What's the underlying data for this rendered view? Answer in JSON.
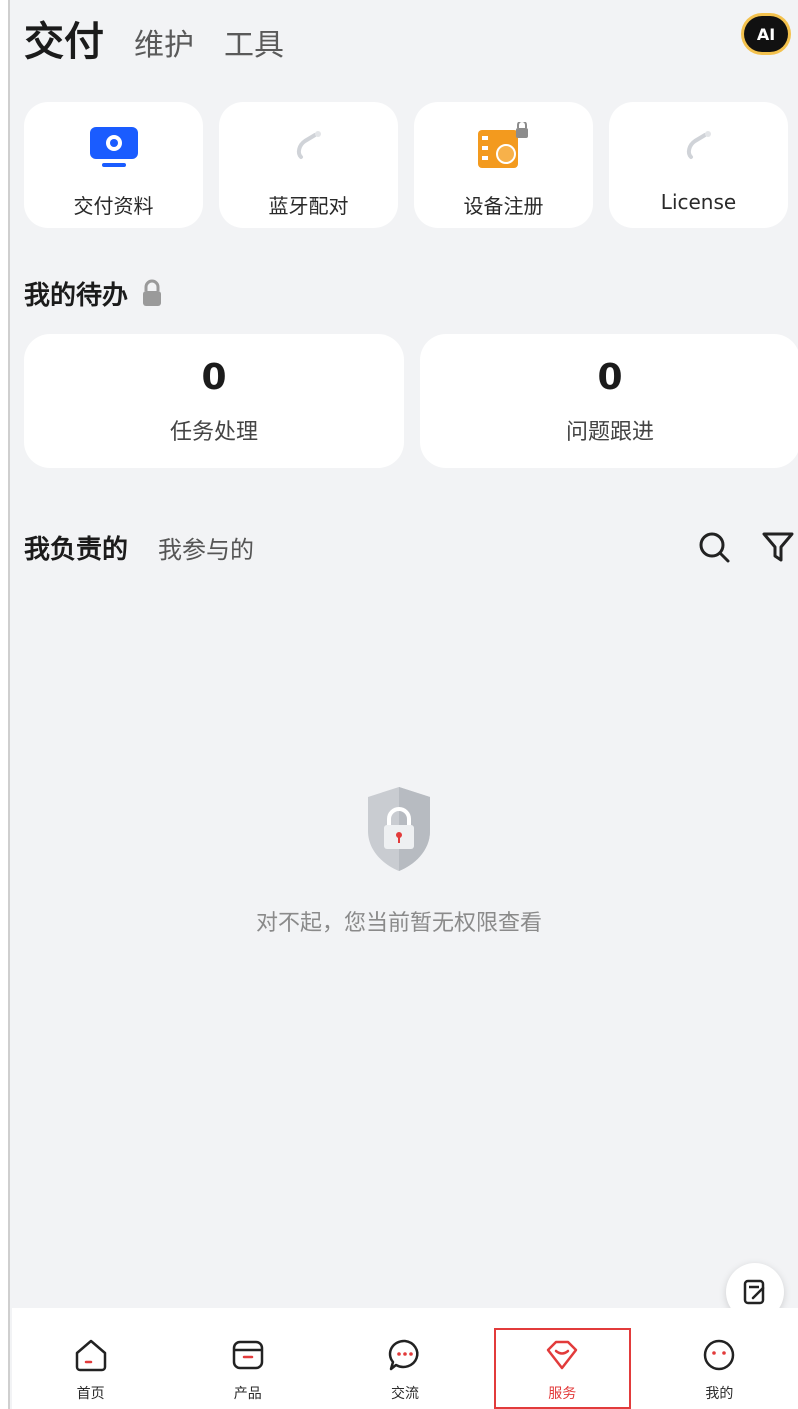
{
  "header": {
    "tabs": [
      "交付",
      "维护",
      "工具"
    ],
    "active_tab": "交付",
    "ai_badge": "AI"
  },
  "tools": [
    {
      "label": "交付资料",
      "icon": "monitor-icon",
      "color": "#1a5cff"
    },
    {
      "label": "蓝牙配对",
      "icon": "bluetooth-pairing-icon",
      "color": "#d0d3d8"
    },
    {
      "label": "设备注册",
      "icon": "device-register-icon",
      "color": "#f39a1e"
    },
    {
      "label": "License",
      "icon": "license-icon",
      "color": "#d0d3d8"
    }
  ],
  "todo": {
    "title": "我的待办",
    "items": [
      {
        "count": "0",
        "label": "任务处理"
      },
      {
        "count": "0",
        "label": "问题跟进"
      }
    ]
  },
  "segment": {
    "tabs": [
      "我负责的",
      "我参与的"
    ],
    "active": "我负责的"
  },
  "empty_state": {
    "message": "对不起，您当前暂无权限查看"
  },
  "bottom_nav": {
    "items": [
      {
        "label": "首页",
        "icon": "home-icon"
      },
      {
        "label": "产品",
        "icon": "product-icon"
      },
      {
        "label": "交流",
        "icon": "chat-icon"
      },
      {
        "label": "服务",
        "icon": "service-icon"
      },
      {
        "label": "我的",
        "icon": "profile-icon"
      }
    ],
    "active": "服务"
  },
  "colors": {
    "background": "#f2f3f5",
    "accent_red": "#e23b3b",
    "brand_blue": "#1a5cff"
  }
}
